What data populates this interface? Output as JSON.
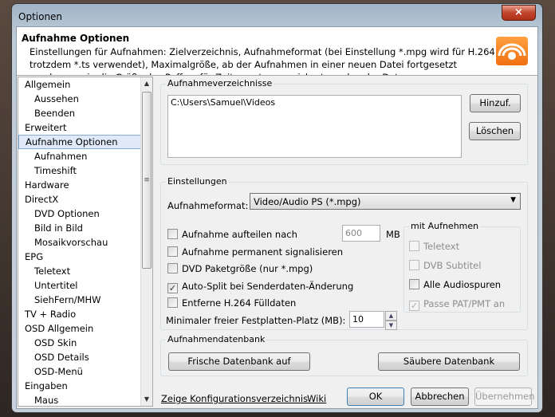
{
  "window": {
    "title": "Optionen",
    "close_icon": "×"
  },
  "header": {
    "title": "Aufnahme Optionen",
    "description": "Einstellungen für Aufnahmen: Zielverzeichnis, Aufnahmeformat (bei Einstellung *.mpg wird für H.264 trotzdem *.ts verwendet), Maximalgröße, ab der Aufnahmen in einer neuen Datei fortgesetzt werden, sowie die Größe des Puffers für Zeitversatz gespeichert werden der Daten"
  },
  "sidebar": {
    "items": [
      {
        "label": "Allgemein",
        "sub": false
      },
      {
        "label": "Aussehen",
        "sub": true
      },
      {
        "label": "Beenden",
        "sub": true
      },
      {
        "label": "Erweitert",
        "sub": false
      },
      {
        "label": "Aufnahme Optionen",
        "sub": false,
        "selected": true
      },
      {
        "label": "Aufnahmen",
        "sub": true
      },
      {
        "label": "Timeshift",
        "sub": true
      },
      {
        "label": "Hardware",
        "sub": false
      },
      {
        "label": "DirectX",
        "sub": false
      },
      {
        "label": "DVD Optionen",
        "sub": true
      },
      {
        "label": "Bild in Bild",
        "sub": true
      },
      {
        "label": "Mosaikvorschau",
        "sub": true
      },
      {
        "label": "EPG",
        "sub": false
      },
      {
        "label": "Teletext",
        "sub": true
      },
      {
        "label": "Untertitel",
        "sub": true
      },
      {
        "label": "SiehFern/MHW",
        "sub": true
      },
      {
        "label": "TV + Radio",
        "sub": false
      },
      {
        "label": "OSD Allgemein",
        "sub": false
      },
      {
        "label": "OSD Skin",
        "sub": true
      },
      {
        "label": "OSD Details",
        "sub": true
      },
      {
        "label": "OSD-Menü",
        "sub": true
      },
      {
        "label": "Eingaben",
        "sub": false
      },
      {
        "label": "Maus",
        "sub": true
      }
    ]
  },
  "dirs": {
    "legend": "Aufnahmeverzeichnisse",
    "items": [
      "C:\\Users\\Samuel\\Videos"
    ],
    "add": "Hinzuf.",
    "delete": "Löschen"
  },
  "settings": {
    "legend": "Einstellungen",
    "format_label": "Aufnahmeformat:",
    "format_value": "Video/Audio PS  (*.mpg)",
    "split_label": "Aufnahme aufteilen nach",
    "split_value": "600",
    "split_unit": "MB",
    "permanent_label": "Aufnahme permanent signalisieren",
    "dvd_label": "DVD Paketgröße (nur *.mpg)",
    "autosplit_label": "Auto-Split bei Senderdaten-Änderung",
    "h264_label": "Entferne H.264 Fülldaten",
    "minfree_label": "Minimaler freier Festplatten-Platz (MB):",
    "minfree_value": "10",
    "with_legend": "mit Aufnehmen",
    "teletext": "Teletext",
    "dvbsub": "DVB Subtitel",
    "audio": "Alle Audiospuren",
    "pat": "Passe PAT/PMT an"
  },
  "db": {
    "legend": "Aufnahmendatenbank",
    "fresh": "Frische Datenbank auf",
    "clean": "Säubere Datenbank"
  },
  "footer": {
    "config_link": "Zeige Konfigurationsverzeichnis",
    "wiki": "Wiki",
    "ok": "OK",
    "cancel": "Abbrechen",
    "apply": "Übernehmen"
  }
}
